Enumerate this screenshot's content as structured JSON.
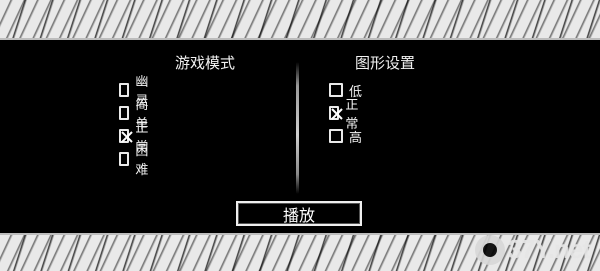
{
  "left_panel": {
    "title": "游戏模式",
    "options": [
      {
        "label": "幽灵",
        "checked": false
      },
      {
        "label": "简单",
        "checked": false
      },
      {
        "label": "正常",
        "checked": true
      },
      {
        "label": "困难",
        "checked": false
      }
    ]
  },
  "right_panel": {
    "title": "图形设置",
    "options": [
      {
        "label": "低",
        "checked": false
      },
      {
        "label": "正常",
        "checked": true
      },
      {
        "label": "高",
        "checked": false
      }
    ]
  },
  "play_button": {
    "label": "播放"
  },
  "watermark": {
    "brand": "37Y.net"
  },
  "colors": {
    "background": "#000000",
    "band": "#e9e9e9",
    "text": "#f2f2f2"
  }
}
